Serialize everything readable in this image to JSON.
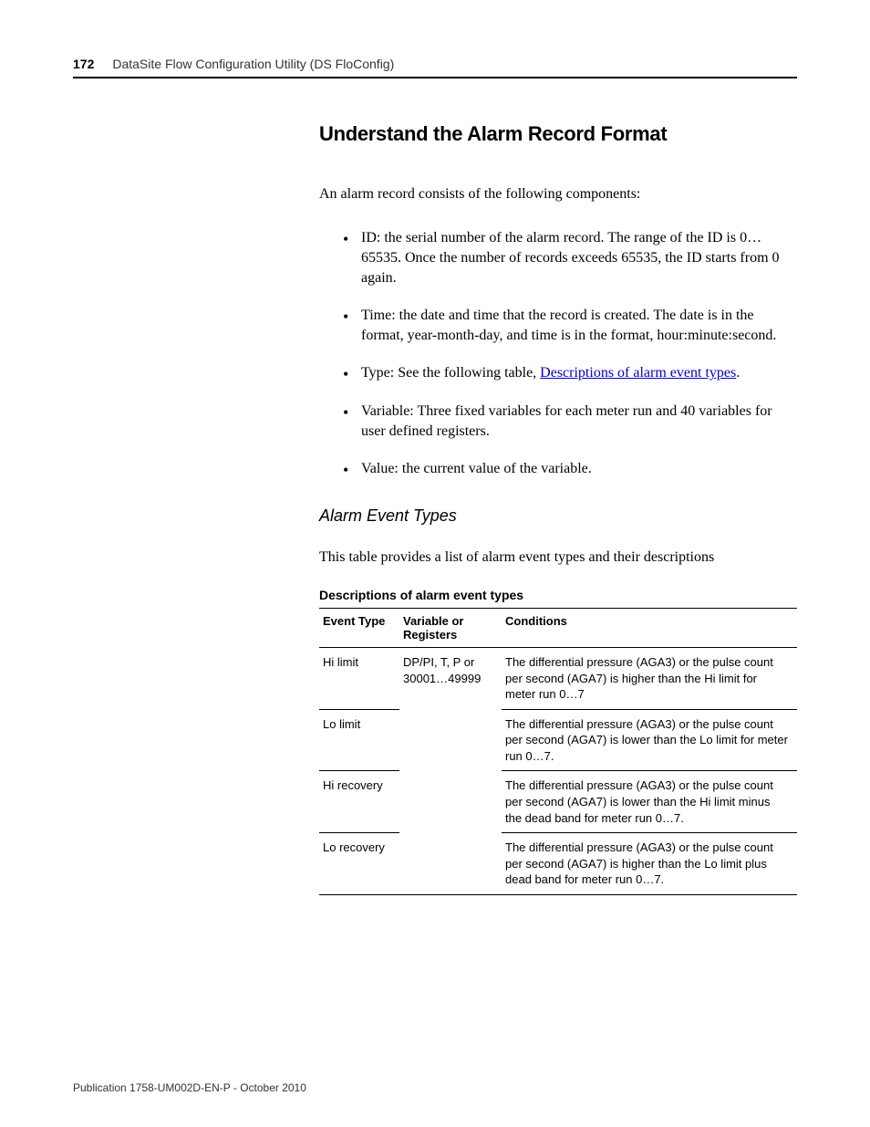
{
  "header": {
    "page_number": "172",
    "title": "DataSite Flow Configuration Utility (DS FloConfig)"
  },
  "main": {
    "section_title": "Understand the Alarm Record Format",
    "intro": "An alarm record consists of the following components:",
    "bullets": {
      "b0": "ID: the serial number of the alarm record. The range of the ID is 0…65535. Once the number of records exceeds 65535, the ID starts from 0 again.",
      "b1": "Time: the date and time that the record is created. The date is in the format, year-month-day, and time is in the format, hour:minute:second.",
      "b2_prefix": "Type: See the following table, ",
      "b2_link": "Descriptions of alarm event types",
      "b2_suffix": ".",
      "b3": "Variable: Three fixed variables for each meter run and 40 variables for user defined registers.",
      "b4": "Value: the current value of the variable."
    },
    "subsection_title": "Alarm Event Types",
    "subsection_intro": "This table provides a list of alarm event types and their descriptions",
    "table_caption": "Descriptions of alarm event types",
    "table": {
      "headers": {
        "c0": "Event Type",
        "c1": "Variable or Registers",
        "c2": "Conditions"
      },
      "rows": {
        "r0": {
          "event_type": "Hi limit",
          "variable": "DP/PI, T, P or 30001…49999",
          "conditions": "The differential pressure (AGA3) or the pulse count per second (AGA7) is higher than the Hi limit for meter run 0…7"
        },
        "r1": {
          "event_type": "Lo limit",
          "conditions": "The differential pressure (AGA3) or the pulse count per second (AGA7) is lower than the Lo limit for meter run 0…7."
        },
        "r2": {
          "event_type": "Hi recovery",
          "conditions": "The differential pressure (AGA3) or the pulse count per second (AGA7) is lower than the Hi limit minus the dead band for meter run 0…7."
        },
        "r3": {
          "event_type": "Lo recovery",
          "conditions": "The differential pressure (AGA3) or the pulse count per second (AGA7) is higher than the Lo limit plus dead band for meter run 0…7."
        }
      }
    }
  },
  "footer": {
    "publication": "Publication 1758-UM002D-EN-P - October 2010"
  }
}
